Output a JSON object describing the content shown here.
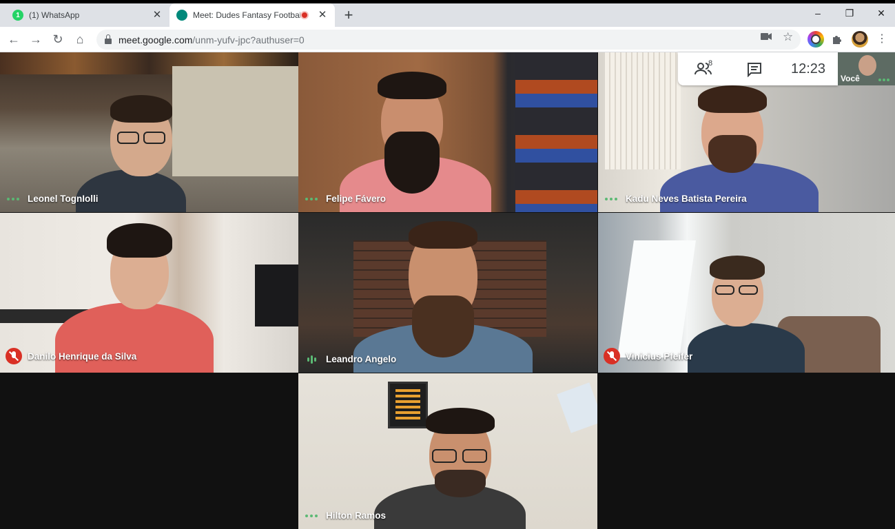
{
  "browser": {
    "tabs": [
      {
        "title": "(1) WhatsApp",
        "badge": "1",
        "active": false
      },
      {
        "title": "Meet: Dudes Fantasy Footbal",
        "active": true
      }
    ],
    "new_tab": "+",
    "window_controls": {
      "minimize": "–",
      "maximize": "❐",
      "close": "✕"
    },
    "url_host": "meet.google.com",
    "url_path": "/unm-yufv-jpc?authuser=0"
  },
  "meet": {
    "participants_count": "8",
    "clock": "12:23",
    "self_label": "Você",
    "participants": [
      {
        "name": "Leonel TognIolli",
        "status": "speaking-dots"
      },
      {
        "name": "Felipe Fávero",
        "status": "speaking-dots"
      },
      {
        "name": "Kadu Neves Batista Pereira",
        "status": "speaking-dots"
      },
      {
        "name": "Danilo Henrique da Silva",
        "status": "muted"
      },
      {
        "name": "Leandro Angelo",
        "status": "speaking-bars"
      },
      {
        "name": "Vinicius Pfeifer",
        "status": "muted"
      },
      {
        "name": "Hilton Ramos",
        "status": "speaking-dots"
      }
    ]
  },
  "colors": {
    "accent_green": "#5bb974",
    "muted_red": "#d93025"
  }
}
